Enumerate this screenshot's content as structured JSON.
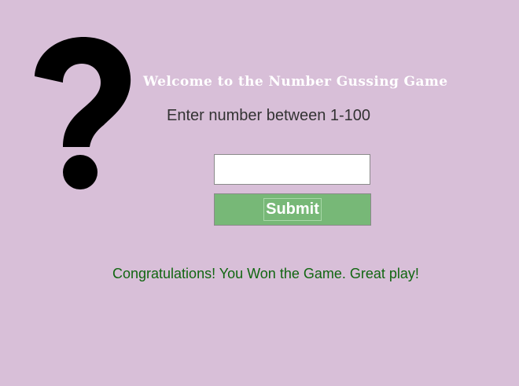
{
  "header": {
    "title": "Welcome to the Number Gussing Game",
    "logo_icon": "question-mark-icon"
  },
  "form": {
    "prompt": "Enter number between 1-100",
    "input_value": "",
    "submit_label": "Submit"
  },
  "result": {
    "message": "Congratulations! You Won the Game. Great play!"
  },
  "colors": {
    "background": "#d8bfd8",
    "title": "#ffffff",
    "button": "#77b877",
    "message": "#116611",
    "icon": "#000000"
  }
}
